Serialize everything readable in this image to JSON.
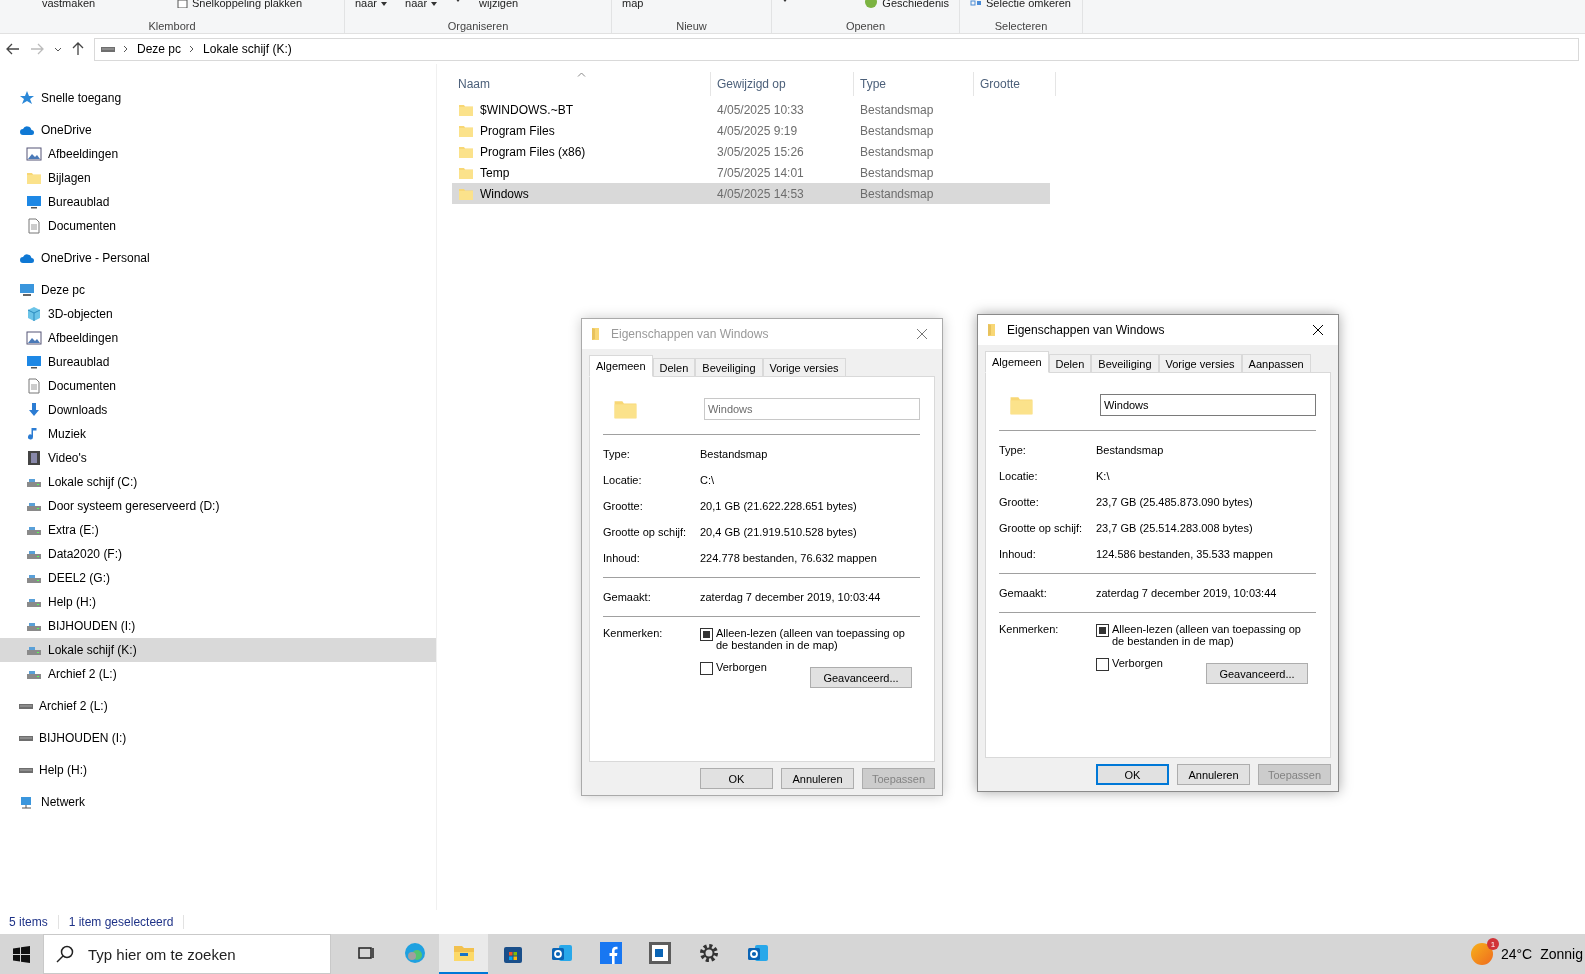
{
  "ribbon": {
    "groups": [
      {
        "label": "Klembord",
        "items": [
          {
            "text": "vastmaken",
            "kind": "text"
          },
          {
            "text": "Snelkoppeling plakken",
            "kind": "shortcut"
          }
        ]
      },
      {
        "label": "Organiseren",
        "items": [
          {
            "text": "naar",
            "kind": "dropdown"
          },
          {
            "text": "naar",
            "kind": "dropdown"
          },
          {
            "kind": "caret"
          },
          {
            "text": "wijzigen",
            "kind": "text"
          }
        ]
      },
      {
        "label": "Nieuw",
        "items": [
          {
            "text": "map",
            "kind": "text"
          }
        ]
      },
      {
        "label": "Openen",
        "items": [
          {
            "kind": "caret"
          },
          {
            "text": "Geschiedenis",
            "kind": "history"
          }
        ]
      },
      {
        "label": "Selecteren",
        "items": [
          {
            "text": "Selectie omkeren",
            "kind": "select"
          }
        ]
      }
    ]
  },
  "address_bar": {
    "crumbs": [
      "Deze pc",
      "Lokale schijf (K:)"
    ]
  },
  "sidebar": {
    "items": [
      {
        "label": "Snelle toegang",
        "kind": "star",
        "selected": false
      },
      {
        "label": "OneDrive",
        "kind": "cloud",
        "selected": false,
        "children": [
          {
            "label": "Afbeeldingen",
            "kind": "image",
            "selected": false
          },
          {
            "label": "Bijlagen",
            "kind": "folder",
            "selected": false
          },
          {
            "label": "Bureaublad",
            "kind": "desktop",
            "selected": false
          },
          {
            "label": "Documenten",
            "kind": "doc",
            "selected": false
          }
        ]
      },
      {
        "label": "OneDrive - Personal",
        "kind": "cloud",
        "selected": false
      },
      {
        "label": "Deze pc",
        "kind": "pc",
        "selected": false,
        "children": [
          {
            "label": "3D-objecten",
            "kind": "cube",
            "selected": false
          },
          {
            "label": "Afbeeldingen",
            "kind": "image",
            "selected": false
          },
          {
            "label": "Bureaublad",
            "kind": "desktop",
            "selected": false
          },
          {
            "label": "Documenten",
            "kind": "doc",
            "selected": false
          },
          {
            "label": "Downloads",
            "kind": "download",
            "selected": false
          },
          {
            "label": "Muziek",
            "kind": "music",
            "selected": false
          },
          {
            "label": "Video's",
            "kind": "video",
            "selected": false
          },
          {
            "label": "Lokale schijf (C:)",
            "kind": "drive",
            "selected": false
          },
          {
            "label": "Door systeem gereserveerd (D:)",
            "kind": "drive",
            "selected": false
          },
          {
            "label": "Extra (E:)",
            "kind": "drive",
            "selected": false
          },
          {
            "label": "Data2020 (F:)",
            "kind": "drive",
            "selected": false
          },
          {
            "label": "DEEL2 (G:)",
            "kind": "drive",
            "selected": false
          },
          {
            "label": "Help (H:)",
            "kind": "drive",
            "selected": false
          },
          {
            "label": "BIJHOUDEN (I:)",
            "kind": "drive",
            "selected": false
          },
          {
            "label": "Lokale schijf (K:)",
            "kind": "drive",
            "selected": true
          },
          {
            "label": "Archief 2 (L:)",
            "kind": "drive",
            "selected": false
          }
        ]
      },
      {
        "label": "Archief 2 (L:)",
        "kind": "usb",
        "selected": false
      },
      {
        "label": "BIJHOUDEN (I:)",
        "kind": "usb",
        "selected": false
      },
      {
        "label": "Help (H:)",
        "kind": "usb",
        "selected": false
      },
      {
        "label": "Netwerk",
        "kind": "network",
        "selected": false
      }
    ]
  },
  "file_list": {
    "columns": [
      "Naam",
      "Gewijzigd op",
      "Type",
      "Grootte"
    ],
    "rows": [
      {
        "name": "$WINDOWS.~BT",
        "modified": "4/05/2025 10:33",
        "type": "Bestandsmap",
        "selected": false
      },
      {
        "name": "Program Files",
        "modified": "4/05/2025 9:19",
        "type": "Bestandsmap",
        "selected": false
      },
      {
        "name": "Program Files (x86)",
        "modified": "3/05/2025 15:26",
        "type": "Bestandsmap",
        "selected": false
      },
      {
        "name": "Temp",
        "modified": "7/05/2025 14:01",
        "type": "Bestandsmap",
        "selected": false
      },
      {
        "name": "Windows",
        "modified": "4/05/2025 14:53",
        "type": "Bestandsmap",
        "selected": true
      }
    ]
  },
  "status_bar": {
    "count": "5 items",
    "selection": "1 item geselecteerd"
  },
  "dialogs": [
    {
      "title": "Eigenschappen van Windows",
      "active": false,
      "tabs": [
        {
          "label": "Algemeen",
          "selected": true
        },
        {
          "label": "Delen",
          "selected": false
        },
        {
          "label": "Beveiliging",
          "selected": false
        },
        {
          "label": "Vorige versies",
          "selected": false
        }
      ],
      "name_field": {
        "value": "Windows"
      },
      "properties": [
        {
          "label": "Type:",
          "value": "Bestandsmap"
        },
        {
          "label": "Locatie:",
          "value": "C:\\"
        },
        {
          "label": "Grootte:",
          "value": "20,1 GB (21.622.228.651 bytes)"
        },
        {
          "label": "Grootte op schijf:",
          "value": "20,4 GB (21.919.510.528 bytes)"
        },
        {
          "label": "Inhoud:",
          "value": "224.778 bestanden, 76.632 mappen"
        }
      ],
      "created": {
        "label": "Gemaakt:",
        "value": "zaterdag 7 december 2019, 10:03:44"
      },
      "attributes": {
        "label": "Kenmerken:",
        "checkboxes": [
          {
            "label": "Alleen-lezen (alleen van toepassing op de bestanden in de map)",
            "indeterminate": true
          },
          {
            "label": "Verborgen",
            "indeterminate": false
          }
        ],
        "advanced": "Geavanceerd..."
      },
      "buttons": [
        {
          "label": "OK",
          "focused": false,
          "disabled": false
        },
        {
          "label": "Annuleren",
          "focused": false,
          "disabled": false
        },
        {
          "label": "Toepassen",
          "focused": false,
          "disabled": true
        }
      ]
    },
    {
      "title": "Eigenschappen van Windows",
      "active": true,
      "tabs": [
        {
          "label": "Algemeen",
          "selected": true
        },
        {
          "label": "Delen",
          "selected": false
        },
        {
          "label": "Beveiliging",
          "selected": false
        },
        {
          "label": "Vorige versies",
          "selected": false
        },
        {
          "label": "Aanpassen",
          "selected": false
        }
      ],
      "name_field": {
        "value": "Windows"
      },
      "properties": [
        {
          "label": "Type:",
          "value": "Bestandsmap"
        },
        {
          "label": "Locatie:",
          "value": "K:\\"
        },
        {
          "label": "Grootte:",
          "value": "23,7 GB (25.485.873.090 bytes)"
        },
        {
          "label": "Grootte op schijf:",
          "value": "23,7 GB (25.514.283.008 bytes)"
        },
        {
          "label": "Inhoud:",
          "value": "124.586 bestanden, 35.533 mappen"
        }
      ],
      "created": {
        "label": "Gemaakt:",
        "value": "zaterdag 7 december 2019, 10:03:44"
      },
      "attributes": {
        "label": "Kenmerken:",
        "checkboxes": [
          {
            "label": "Alleen-lezen (alleen van toepassing op de bestanden in de map)",
            "indeterminate": true
          },
          {
            "label": "Verborgen",
            "indeterminate": false
          }
        ],
        "advanced": "Geavanceerd..."
      },
      "buttons": [
        {
          "label": "OK",
          "focused": true,
          "disabled": false
        },
        {
          "label": "Annuleren",
          "focused": false,
          "disabled": false
        },
        {
          "label": "Toepassen",
          "focused": false,
          "disabled": true
        }
      ]
    }
  ],
  "taskbar": {
    "search": {
      "placeholder": "Typ hier om te zoeken"
    },
    "apps": [
      {
        "kind": "taskview",
        "selected": false
      },
      {
        "kind": "edge",
        "selected": false
      },
      {
        "kind": "explorer",
        "selected": true
      },
      {
        "kind": "store",
        "selected": false
      },
      {
        "kind": "outlook",
        "selected": false
      },
      {
        "kind": "facebook",
        "selected": false
      },
      {
        "kind": "outlookframe",
        "selected": false
      },
      {
        "kind": "settings",
        "selected": false
      },
      {
        "kind": "outlook",
        "selected": false
      }
    ],
    "weather": {
      "badge": "1",
      "temperature": "24°C",
      "condition": "Zonnig"
    }
  }
}
